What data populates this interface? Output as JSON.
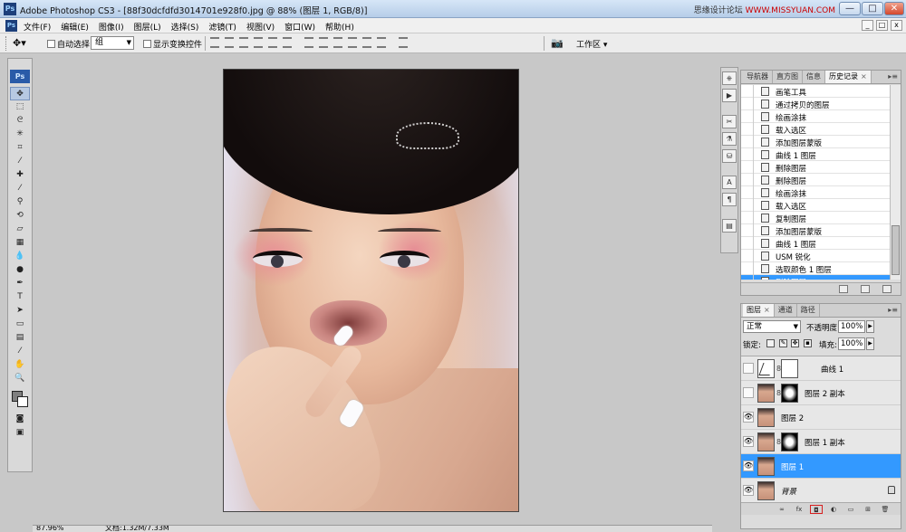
{
  "window": {
    "app_icon": "Ps",
    "title": "Adobe Photoshop CS3 - [88f30dcfdfd3014701e928f0.jpg @ 88% (图层 1, RGB/8)]",
    "watermark_prefix": "思缘设计论坛",
    "watermark_url": "WWW.MISSYUAN.COM",
    "controls": [
      "—",
      "□",
      "✕"
    ]
  },
  "menu": {
    "items": [
      "文件(F)",
      "编辑(E)",
      "图像(I)",
      "图层(L)",
      "选择(S)",
      "滤镜(T)",
      "视图(V)",
      "窗口(W)",
      "帮助(H)"
    ],
    "doc_controls": [
      "_",
      "□",
      "x"
    ]
  },
  "options": {
    "tool_icon": "move-tool-icon",
    "auto_select_label": "自动选择:",
    "auto_select_value": "组",
    "show_transform_label": "显示变换控件",
    "workspace_label": "工作区 ▾"
  },
  "toolbox": {
    "logo": "Ps",
    "tools": [
      {
        "name": "move-tool",
        "glyph": "✥",
        "active": true
      },
      {
        "name": "marquee-tool",
        "glyph": "⬚"
      },
      {
        "name": "lasso-tool",
        "glyph": "ᘓ"
      },
      {
        "name": "magic-wand-tool",
        "glyph": "✳"
      },
      {
        "name": "crop-tool",
        "glyph": "⌗"
      },
      {
        "name": "slice-tool",
        "glyph": "⁄"
      },
      {
        "name": "healing-brush-tool",
        "glyph": "✚"
      },
      {
        "name": "brush-tool",
        "glyph": "⁄"
      },
      {
        "name": "clone-stamp-tool",
        "glyph": "⚲"
      },
      {
        "name": "history-brush-tool",
        "glyph": "⟲"
      },
      {
        "name": "eraser-tool",
        "glyph": "▱"
      },
      {
        "name": "gradient-tool",
        "glyph": "▦"
      },
      {
        "name": "blur-tool",
        "glyph": "💧"
      },
      {
        "name": "dodge-tool",
        "glyph": "●"
      },
      {
        "name": "pen-tool",
        "glyph": "✒"
      },
      {
        "name": "type-tool",
        "glyph": "T"
      },
      {
        "name": "path-selection-tool",
        "glyph": "➤"
      },
      {
        "name": "shape-tool",
        "glyph": "▭"
      },
      {
        "name": "notes-tool",
        "glyph": "▤"
      },
      {
        "name": "eyedropper-tool",
        "glyph": "⁄"
      },
      {
        "name": "hand-tool",
        "glyph": "✋"
      },
      {
        "name": "zoom-tool",
        "glyph": "🔍"
      }
    ],
    "bottom_tools": [
      {
        "name": "quick-mask",
        "glyph": "◙"
      },
      {
        "name": "screen-mode",
        "glyph": "▣"
      }
    ]
  },
  "status": {
    "zoom": "87.96%",
    "doc": "文档:1.32M/7.33M"
  },
  "iconstrip": [
    "⎈",
    "▶",
    "✂",
    "⚗",
    "⛁",
    "A",
    "¶",
    "▤"
  ],
  "history_panel": {
    "tabs": [
      "导航器",
      "直方图",
      "信息",
      "历史记录"
    ],
    "active_tab": 3,
    "items": [
      {
        "label": "画笔工具",
        "selected": false
      },
      {
        "label": "通过拷贝的图层",
        "selected": false
      },
      {
        "label": "绘画涂抹",
        "selected": false
      },
      {
        "label": "载入选区",
        "selected": false
      },
      {
        "label": "添加图层蒙版",
        "selected": false
      },
      {
        "label": "曲线 1 图层",
        "selected": false
      },
      {
        "label": "删除图层",
        "selected": false
      },
      {
        "label": "删除图层",
        "selected": false
      },
      {
        "label": "绘画涂抹",
        "selected": false
      },
      {
        "label": "载入选区",
        "selected": false
      },
      {
        "label": "复制图层",
        "selected": false
      },
      {
        "label": "添加图层蒙版",
        "selected": false
      },
      {
        "label": "曲线 1 图层",
        "selected": false
      },
      {
        "label": "USM 锐化",
        "selected": false
      },
      {
        "label": "选取颜色 1 图层",
        "selected": false
      },
      {
        "label": "删除图层",
        "selected": true
      }
    ]
  },
  "layers_panel": {
    "tabs": [
      "图层",
      "通道",
      "路径"
    ],
    "active_tab": 0,
    "blend_mode": "正常",
    "opacity_label": "不透明度:",
    "opacity": "100%",
    "lock_label": "锁定:",
    "fill_label": "填充:",
    "fill": "100%",
    "layers": [
      {
        "name": "曲线 1",
        "type": "curves",
        "visible": false,
        "mask": "white",
        "selected": false
      },
      {
        "name": "图层 2 副本",
        "type": "image",
        "visible": false,
        "mask": "dark",
        "selected": false
      },
      {
        "name": "图层 2",
        "type": "image",
        "visible": true,
        "mask": null,
        "selected": false
      },
      {
        "name": "图层 1 副本",
        "type": "image",
        "visible": true,
        "mask": "dark",
        "selected": false
      },
      {
        "name": "图层 1",
        "type": "image",
        "visible": true,
        "mask": null,
        "selected": true
      },
      {
        "name": "背景",
        "type": "image",
        "visible": true,
        "mask": null,
        "selected": false,
        "locked": true
      }
    ],
    "footer_icons": [
      "∞",
      "fx",
      "◘",
      "◐",
      "▭",
      "⊞",
      "🗑"
    ]
  },
  "colors": {
    "selection": "#3399ff",
    "workspace_bg": "#c8c8c8"
  }
}
